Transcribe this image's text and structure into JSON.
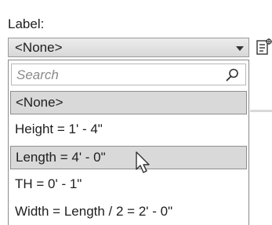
{
  "label_text": "Label:",
  "combo": {
    "value": "<None>",
    "arrow_icon": "chevron-down-icon"
  },
  "side_button_icon": "edit-label-icon",
  "search": {
    "placeholder": "Search",
    "icon": "search-icon"
  },
  "options": [
    {
      "label": "<None>",
      "highlighted": true
    },
    {
      "label": "Height = 1' - 4\"",
      "highlighted": false
    },
    {
      "label": "Length = 4' - 0\"",
      "highlighted": true
    },
    {
      "label": "TH = 0' - 1\"",
      "highlighted": false
    },
    {
      "label": "Width = Length / 2 = 2' - 0\"",
      "highlighted": false
    }
  ],
  "colors": {
    "highlight": "#d9d9d9",
    "border": "#8e8e8e"
  }
}
